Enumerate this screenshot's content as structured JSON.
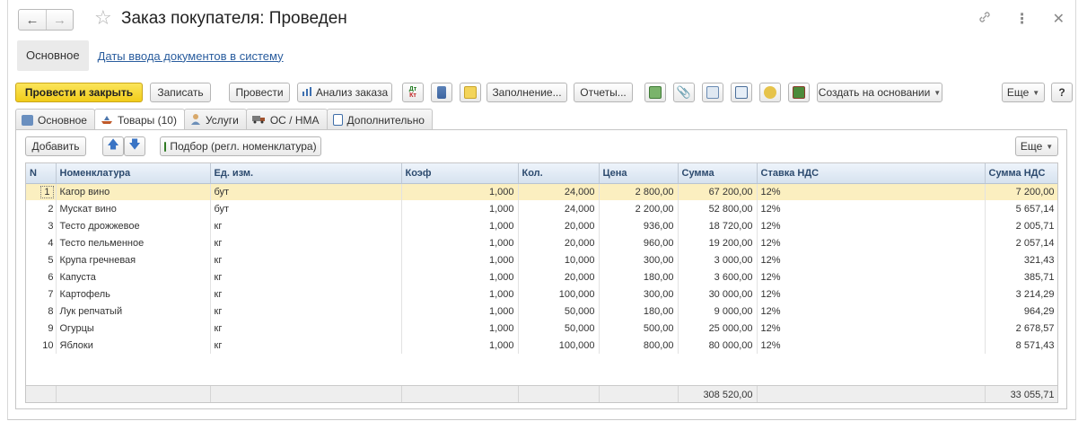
{
  "window": {
    "title": "Заказ покупателя: Проведен",
    "nav_back": "←",
    "nav_forward": "→"
  },
  "sections": {
    "main": "Основное",
    "link": "Даты ввода документов в систему"
  },
  "toolbar": {
    "post_close": "Провести и закрыть",
    "save": "Записать",
    "post": "Провести",
    "analysis": "Анализ заказа",
    "fill": "Заполнение...",
    "reports": "Отчеты...",
    "create_based": "Создать на основании",
    "more": "Еще",
    "help": "?"
  },
  "tabs": [
    {
      "label": "Основное"
    },
    {
      "label": "Товары (10)"
    },
    {
      "label": "Услуги"
    },
    {
      "label": "ОС / НМА"
    },
    {
      "label": "Дополнительно"
    }
  ],
  "panel_toolbar": {
    "add": "Добавить",
    "select": "Подбор (регл. номенклатура)",
    "more": "Еще"
  },
  "table": {
    "columns": [
      "N",
      "Номенклатура",
      "Ед. изм.",
      "Коэф",
      "Кол.",
      "Цена",
      "Сумма",
      "Ставка НДС",
      "Сумма НДС"
    ],
    "rows": [
      [
        "1",
        "Кагор вино",
        "бут",
        "1,000",
        "24,000",
        "2 800,00",
        "67 200,00",
        "12%",
        "7 200,00"
      ],
      [
        "2",
        "Мускат вино",
        "бут",
        "1,000",
        "24,000",
        "2 200,00",
        "52 800,00",
        "12%",
        "5 657,14"
      ],
      [
        "3",
        "Тесто дрожжевое",
        "кг",
        "1,000",
        "20,000",
        "936,00",
        "18 720,00",
        "12%",
        "2 005,71"
      ],
      [
        "4",
        "Тесто пельменное",
        "кг",
        "1,000",
        "20,000",
        "960,00",
        "19 200,00",
        "12%",
        "2 057,14"
      ],
      [
        "5",
        "Крупа гречневая",
        "кг",
        "1,000",
        "10,000",
        "300,00",
        "3 000,00",
        "12%",
        "321,43"
      ],
      [
        "6",
        "Капуста",
        "кг",
        "1,000",
        "20,000",
        "180,00",
        "3 600,00",
        "12%",
        "385,71"
      ],
      [
        "7",
        "Картофель",
        "кг",
        "1,000",
        "100,000",
        "300,00",
        "30 000,00",
        "12%",
        "3 214,29"
      ],
      [
        "8",
        "Лук репчатый",
        "кг",
        "1,000",
        "50,000",
        "180,00",
        "9 000,00",
        "12%",
        "964,29"
      ],
      [
        "9",
        "Огурцы",
        "кг",
        "1,000",
        "50,000",
        "500,00",
        "25 000,00",
        "12%",
        "2 678,57"
      ],
      [
        "10",
        "Яблоки",
        "кг",
        "1,000",
        "100,000",
        "800,00",
        "80 000,00",
        "12%",
        "8 571,43"
      ]
    ],
    "totals": {
      "sum": "308 520,00",
      "vat": "33 055,71"
    }
  },
  "colors": {
    "primary_button": "#f1cc1a",
    "header_text": "#2c4a6e",
    "selected_row": "#fbefc0",
    "link": "#2a5d9e"
  }
}
